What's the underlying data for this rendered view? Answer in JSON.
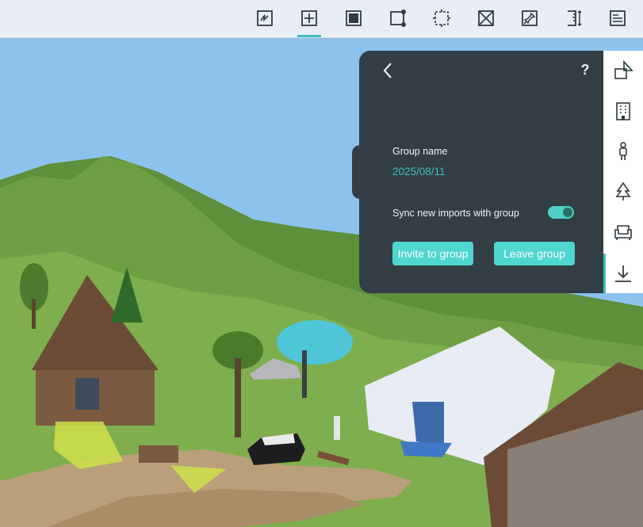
{
  "toolbar": {
    "items": [
      {
        "name": "sketch-tool-icon"
      },
      {
        "name": "add-tool-icon",
        "active": true
      },
      {
        "name": "fill-select-tool-icon"
      },
      {
        "name": "node-select-tool-icon"
      },
      {
        "name": "resize-tool-icon"
      },
      {
        "name": "delete-box-tool-icon"
      },
      {
        "name": "pin-tool-icon"
      },
      {
        "name": "measure-tool-icon"
      },
      {
        "name": "document-tool-icon"
      }
    ],
    "accent": "#3fc1b8"
  },
  "panel": {
    "help": "?",
    "group_name_label": "Group name",
    "group_name_value": "2025/08/11",
    "sync_label": "Sync new imports with group",
    "sync_enabled": true,
    "invite_label": "Invite to group",
    "leave_label": "Leave group",
    "bg_color": "#333d44",
    "button_color": "#4fd6cf"
  },
  "sidebar": {
    "items": [
      {
        "name": "shapes-icon"
      },
      {
        "name": "building-icon"
      },
      {
        "name": "person-icon"
      },
      {
        "name": "tree-icon"
      },
      {
        "name": "armchair-icon"
      },
      {
        "name": "download-icon",
        "active": true
      }
    ]
  }
}
